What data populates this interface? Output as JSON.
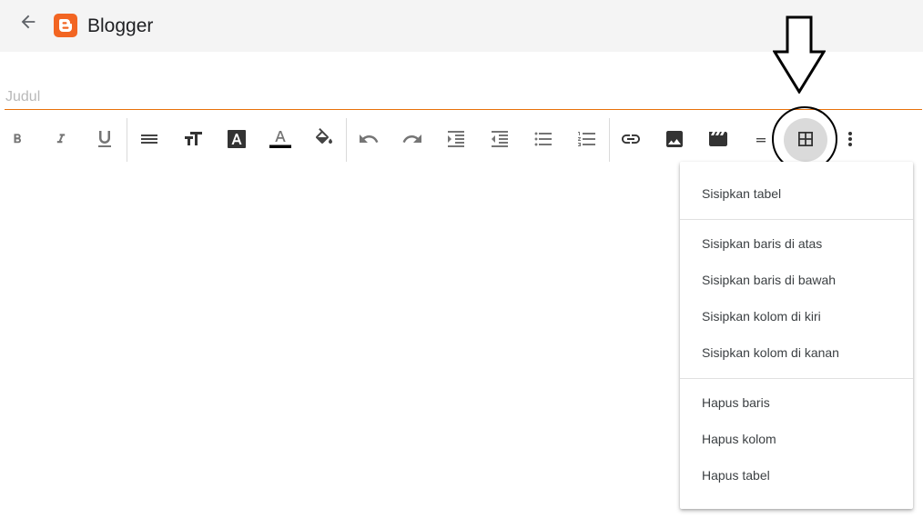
{
  "header": {
    "title": "Blogger",
    "back_icon": "arrow-back-icon",
    "logo_icon": "blogger-logo-icon",
    "logo_color": "#f26522"
  },
  "editor": {
    "title_placeholder": "Judul",
    "accent_color": "#e8710a"
  },
  "toolbar": {
    "buttons": [
      "bold-icon",
      "italic-icon",
      "underline-icon",
      "align-icon",
      "font-size-icon",
      "text-format-icon",
      "text-color-icon",
      "highlight-color-icon",
      "undo-icon",
      "redo-icon",
      "indent-icon",
      "outdent-icon",
      "bulleted-list-icon",
      "numbered-list-icon",
      "link-icon",
      "image-icon",
      "video-icon",
      "divider-icon",
      "table-icon",
      "more-icon"
    ]
  },
  "table_menu": {
    "items": [
      "Sisipkan tabel",
      "Sisipkan baris di atas",
      "Sisipkan baris di bawah",
      "Sisipkan kolom di kiri",
      "Sisipkan kolom di kanan",
      "Hapus baris",
      "Hapus kolom",
      "Hapus tabel"
    ]
  }
}
